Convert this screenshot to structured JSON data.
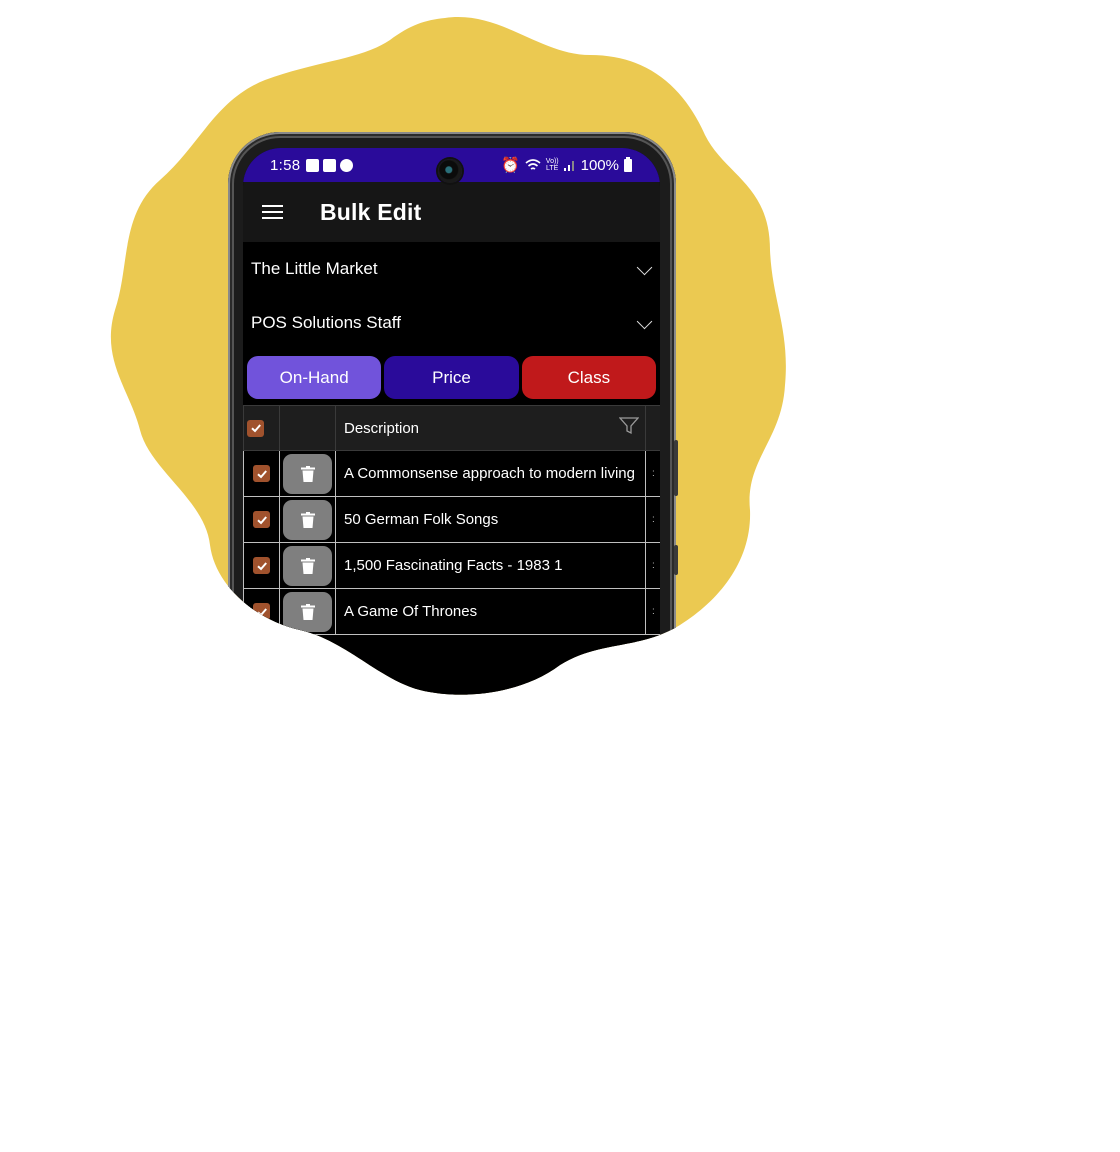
{
  "colors": {
    "blob": "#ebc951",
    "status_bar": "#2a0b9a",
    "app_bar": "#161616",
    "tab_on_hand": "#7153db",
    "tab_price": "#2a0b9a",
    "tab_class": "#c0191b",
    "checkbox": "#a0522d",
    "delete_button": "#7f7f7f"
  },
  "status_bar": {
    "time": "1:58",
    "left_icons": [
      "gallery-icon",
      "cast-icon",
      "shazam-icon"
    ],
    "right_icons": [
      "alarm-icon",
      "wifi-icon",
      "volte-icon",
      "signal-icon"
    ],
    "volte_text_top": "Vo))",
    "volte_text_bottom": "LTE",
    "battery": "100%"
  },
  "app_bar": {
    "title": "Bulk Edit"
  },
  "pickers": [
    {
      "label": "The Little Market"
    },
    {
      "label": "POS Solutions Staff"
    }
  ],
  "tabs": [
    {
      "label": "On-Hand"
    },
    {
      "label": "Price"
    },
    {
      "label": "Class"
    }
  ],
  "table": {
    "header": {
      "select_all_checked": true,
      "description": "Description"
    },
    "rows": [
      {
        "checked": true,
        "description": "A Commonsense approach to modern living"
      },
      {
        "checked": true,
        "description": "50 German Folk Songs"
      },
      {
        "checked": true,
        "description": "1,500 Fascinating Facts - 1983 1"
      },
      {
        "checked": true,
        "description": "A Game Of Thrones"
      }
    ]
  }
}
